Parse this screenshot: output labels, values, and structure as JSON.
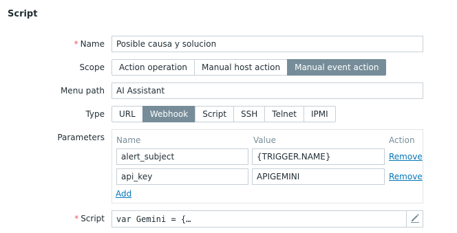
{
  "title": "Script",
  "form": {
    "name": {
      "required": "*",
      "label": "Name",
      "value": "Posible causa y solucion"
    },
    "scope": {
      "label": "Scope",
      "options": [
        "Action operation",
        "Manual host action",
        "Manual event action"
      ],
      "selected": "Manual event action"
    },
    "menu_path": {
      "label": "Menu path",
      "value": "AI Assistant"
    },
    "type": {
      "label": "Type",
      "options": [
        "URL",
        "Webhook",
        "Script",
        "SSH",
        "Telnet",
        "IPMI"
      ],
      "selected": "Webhook"
    },
    "parameters": {
      "label": "Parameters",
      "headers": {
        "name": "Name",
        "value": "Value",
        "action": "Action"
      },
      "rows": [
        {
          "name": "alert_subject",
          "value": "{TRIGGER.NAME}",
          "action": "Remove"
        },
        {
          "name": "api_key",
          "value": "APIGEMINI",
          "action": "Remove"
        }
      ],
      "add_label": "Add"
    },
    "script": {
      "required": "*",
      "label": "Script",
      "value": "var Gemini = {…"
    }
  },
  "icons": {
    "edit": "pencil-icon"
  },
  "colors": {
    "active": "#768d99",
    "link": "#0275b8",
    "required": "#e45959"
  }
}
